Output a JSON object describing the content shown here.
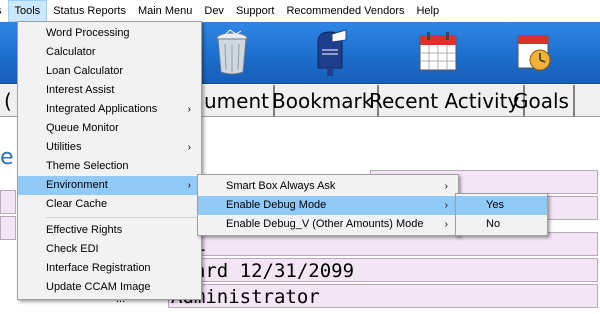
{
  "menubar": {
    "items": [
      "s",
      "Tools",
      "Status Reports",
      "Main Menu",
      "Dev",
      "Support",
      "Recommended Vendors",
      "Help"
    ]
  },
  "toolbar": {
    "icons": [
      "trash-can-icon",
      "mailbox-icon",
      "calendar-icon",
      "schedule-clock-icon"
    ]
  },
  "tabs": [
    "(",
    "ument",
    "Bookmark",
    "Recent Activity",
    "Goals"
  ],
  "page": {
    "heading_fragment": "e"
  },
  "form": {
    "field_values": [
      "TML",
      "ndard 12/31/2099",
      "Administrator"
    ],
    "label_fragment": "..."
  },
  "tools_menu": {
    "items": [
      {
        "label": "Word Processing"
      },
      {
        "label": "Calculator"
      },
      {
        "label": "Loan Calculator"
      },
      {
        "label": "Interest Assist"
      },
      {
        "label": "Integrated Applications",
        "arrow": "›"
      },
      {
        "label": "Queue Monitor"
      },
      {
        "label": "Utilities",
        "arrow": "›"
      },
      {
        "label": "Theme Selection"
      },
      {
        "label": "Environment",
        "arrow": "›"
      },
      {
        "label": "Clear Cache"
      },
      {
        "label": "Effective Rights"
      },
      {
        "label": "Check EDI"
      },
      {
        "label": "Interface Registration"
      },
      {
        "label": "Update CCAM Image"
      }
    ]
  },
  "environment_menu": {
    "items": [
      {
        "label": "Smart Box Always Ask",
        "arrow": "›"
      },
      {
        "label": "Enable Debug Mode",
        "arrow": "›"
      },
      {
        "label": "Enable Debug_V (Other Amounts) Mode",
        "arrow": "›"
      }
    ]
  },
  "debug_menu": {
    "items": [
      {
        "label": "Yes"
      },
      {
        "label": "No"
      }
    ]
  },
  "colors": {
    "toolbar_blue": "#1d6fcf",
    "menu_highlight": "#91c9f7",
    "field_bg": "#f2e6f4",
    "heading_blue": "#2a6fc9"
  }
}
